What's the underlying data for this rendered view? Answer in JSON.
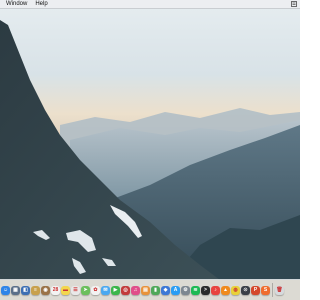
{
  "menubar": {
    "items": [
      "Window",
      "Help"
    ],
    "right_icon": "control-icon"
  },
  "dock": {
    "apps": [
      {
        "name": "finder-icon",
        "glyph": "☺",
        "color": "#2f84e8"
      },
      {
        "name": "launchpad-icon",
        "glyph": "▦",
        "color": "#5b6f89"
      },
      {
        "name": "preview-icon",
        "glyph": "◧",
        "color": "#3d6fb3"
      },
      {
        "name": "notes-icon",
        "glyph": "≡",
        "color": "#c8a04c"
      },
      {
        "name": "contacts-icon",
        "glyph": "◉",
        "color": "#9a7247"
      },
      {
        "name": "calendar-icon",
        "glyph": "28",
        "color": "#f3f3f3"
      },
      {
        "name": "stickies-icon",
        "glyph": "▬",
        "color": "#f3d64d"
      },
      {
        "name": "reminders-icon",
        "glyph": "☰",
        "color": "#e9e9e9"
      },
      {
        "name": "maps-icon",
        "glyph": "➤",
        "color": "#6bbf5c"
      },
      {
        "name": "photos-icon",
        "glyph": "✿",
        "color": "#f2f2f2"
      },
      {
        "name": "messages-icon",
        "glyph": "✉",
        "color": "#4aa8f0"
      },
      {
        "name": "facetime-icon",
        "glyph": "▶",
        "color": "#3cb64b"
      },
      {
        "name": "photo-booth-icon",
        "glyph": "◎",
        "color": "#c23b3b"
      },
      {
        "name": "itunes-icon",
        "glyph": "♫",
        "color": "#e04e8a"
      },
      {
        "name": "ibooks-icon",
        "glyph": "▤",
        "color": "#e8923a"
      },
      {
        "name": "numbers-icon",
        "glyph": "▮",
        "color": "#4fa85a"
      },
      {
        "name": "keynote-icon",
        "glyph": "◆",
        "color": "#3d78d6"
      },
      {
        "name": "app-store-icon",
        "glyph": "A",
        "color": "#2a9df4"
      },
      {
        "name": "system-preferences-icon",
        "glyph": "⚙",
        "color": "#7d8791"
      },
      {
        "name": "spotify-icon",
        "glyph": "≋",
        "color": "#1db954"
      },
      {
        "name": "terminal-icon",
        "glyph": ">",
        "color": "#2b2b2b"
      },
      {
        "name": "music-icon",
        "glyph": "♪",
        "color": "#e8433f"
      },
      {
        "name": "vlc-icon",
        "glyph": "▲",
        "color": "#f08a1c"
      },
      {
        "name": "chrome-icon",
        "glyph": "◍",
        "color": "#e8d13a"
      },
      {
        "name": "steam-icon",
        "glyph": "⊙",
        "color": "#3a3f47"
      },
      {
        "name": "powerpoint-icon",
        "glyph": "P",
        "color": "#d4472b"
      },
      {
        "name": "sublime-icon",
        "glyph": "S",
        "color": "#ef6c2e"
      }
    ],
    "trash": {
      "name": "trash-icon",
      "glyph": "🗑",
      "color": "#d6dadd"
    }
  }
}
